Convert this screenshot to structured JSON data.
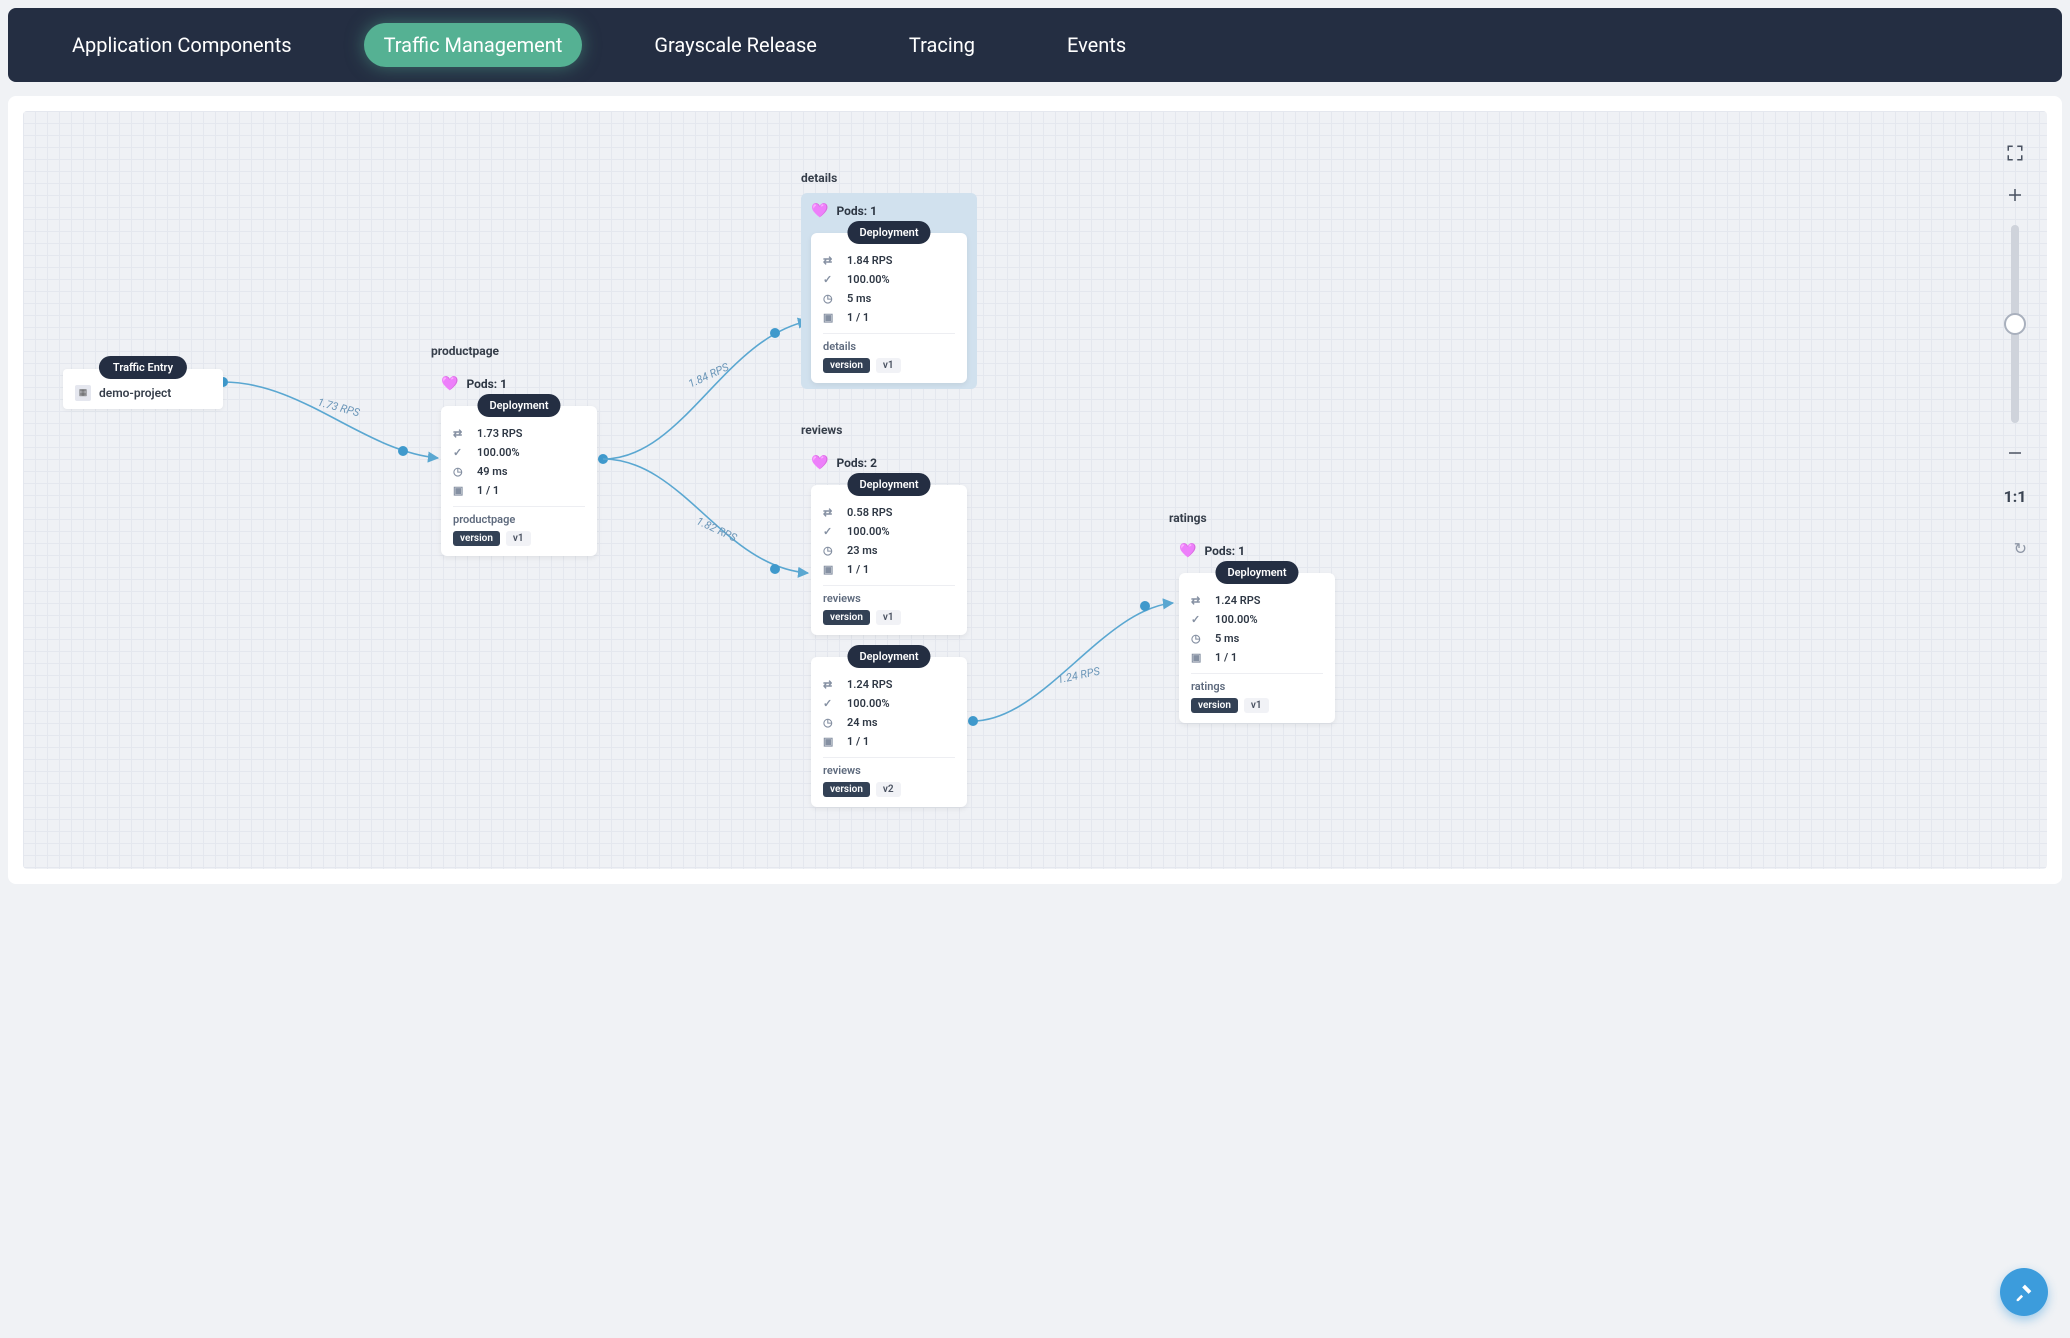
{
  "nav": {
    "items": [
      {
        "label": "Application Components"
      },
      {
        "label": "Traffic Management"
      },
      {
        "label": "Grayscale Release"
      },
      {
        "label": "Tracing"
      },
      {
        "label": "Events"
      }
    ],
    "active_index": 1
  },
  "entry": {
    "pill": "Traffic Entry",
    "project": "demo-project"
  },
  "edges": {
    "e0": "1.73 RPS",
    "e1": "1.84 RPS",
    "e2": "1.82 RPS",
    "e3": "1.24 RPS"
  },
  "services": {
    "productpage": {
      "title": "productpage",
      "pods": "Pods: 1",
      "deployments": [
        {
          "pill": "Deployment",
          "rps": "1.73 RPS",
          "success": "100.00%",
          "latency": "49 ms",
          "replicas": "1 / 1",
          "name": "productpage",
          "tag_key": "version",
          "tag_val": "v1"
        }
      ]
    },
    "details": {
      "title": "details",
      "pods": "Pods: 1",
      "deployments": [
        {
          "pill": "Deployment",
          "rps": "1.84 RPS",
          "success": "100.00%",
          "latency": "5 ms",
          "replicas": "1 / 1",
          "name": "details",
          "tag_key": "version",
          "tag_val": "v1"
        }
      ]
    },
    "reviews": {
      "title": "reviews",
      "pods": "Pods: 2",
      "deployments": [
        {
          "pill": "Deployment",
          "rps": "0.58 RPS",
          "success": "100.00%",
          "latency": "23 ms",
          "replicas": "1 / 1",
          "name": "reviews",
          "tag_key": "version",
          "tag_val": "v1"
        },
        {
          "pill": "Deployment",
          "rps": "1.24 RPS",
          "success": "100.00%",
          "latency": "24 ms",
          "replicas": "1 / 1",
          "name": "reviews",
          "tag_key": "version",
          "tag_val": "v2"
        }
      ]
    },
    "ratings": {
      "title": "ratings",
      "pods": "Pods: 1",
      "deployments": [
        {
          "pill": "Deployment",
          "rps": "1.24 RPS",
          "success": "100.00%",
          "latency": "5 ms",
          "replicas": "1 / 1",
          "name": "ratings",
          "tag_key": "version",
          "tag_val": "v1"
        }
      ]
    }
  },
  "controls": {
    "ratio": "1:1"
  }
}
